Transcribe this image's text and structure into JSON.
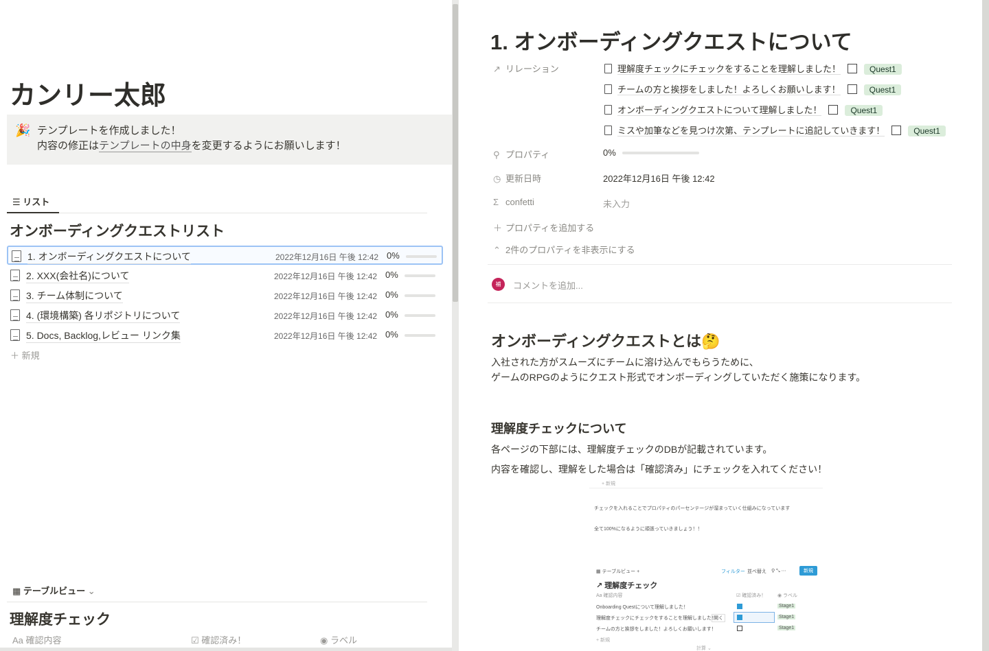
{
  "left": {
    "page_title": "カンリー太郎",
    "callout": {
      "line1": "テンプレートを作成しました！",
      "line2_pre": "内容の修正は",
      "line2_link": "テンプレートの中身",
      "line2_post": "を変更するようにお願いします！"
    },
    "list_tab": "リスト",
    "list_title": "オンボーディングクエストリスト",
    "rows": [
      {
        "name": "1. オンボーディングクエストについて",
        "date": "2022年12月16日 午後 12:42",
        "progress": "0%"
      },
      {
        "name": "2. XXX(会社名)について",
        "date": "2022年12月16日 午後 12:42",
        "progress": "0%"
      },
      {
        "name": "3. チーム体制について",
        "date": "2022年12月16日 午後 12:42",
        "progress": "0%"
      },
      {
        "name": "4. (環境構築) 各リポジトリについて",
        "date": "2022年12月16日 午後 12:42",
        "progress": "0%"
      },
      {
        "name": "5. Docs, Backlog,レビュー リンク集",
        "date": "2022年12月16日 午後 12:42",
        "progress": "0%"
      }
    ],
    "new_label": "新規",
    "table_tab": "テーブルビュー",
    "table_title": "理解度チェック",
    "columns": [
      {
        "icon": "Aa",
        "label": "確認内容"
      },
      {
        "icon": "☑",
        "label": "確認済み！"
      },
      {
        "icon": "◉",
        "label": "ラベル"
      }
    ]
  },
  "right": {
    "page_title": "1. オンボーディングクエストについて",
    "relation_label": "リレーション",
    "relations": [
      {
        "title": "理解度チェックにチェックをすることを理解しました！",
        "tag": "Quest1"
      },
      {
        "title": "チームの方と挨拶をしました！よろしくお願いします！",
        "tag": "Quest1"
      },
      {
        "title": "オンボーディングクエストについて理解しました！",
        "tag": "Quest1"
      },
      {
        "title": "ミスや加筆などを見つけ次第、テンプレートに追記していきます！",
        "tag": "Quest1"
      }
    ],
    "property_label": "プロパティ",
    "property_value": "0%",
    "updated_label": "更新日時",
    "updated_value": "2022年12月16日 午後 12:42",
    "confetti_label": "confetti",
    "confetti_value": "未入力",
    "add_property": "プロパティを追加する",
    "hide_properties": "2件のプロパティを非表示にする",
    "avatar": "補",
    "comment_placeholder": "コメントを追加...",
    "h_about": "オンボーディングクエストとは🤔",
    "about1": "入社された方がスムーズにチームに溶け込んでもらうために、",
    "about2": "ゲームのRPGのようにクエスト形式でオンボーディングしていただく施策になります。",
    "h_check": "理解度チェックについて",
    "check1": "各ページの下部には、理解度チェックのDBが記載されています。",
    "check2": "内容を確認し、理解をした場合は「確認済み」にチェックを入れてください！",
    "embed": {
      "new_top": "+ 新規",
      "text1": "チェックを入れることでプロパティのパーセンテージが溜まっていく仕組みになっています",
      "text2": "全て100%になるように頑張っていきましょう！！",
      "view": "テーブルビュー",
      "filter": "フィルター",
      "sort": "並べ替え",
      "new_btn": "新規",
      "title": "↗ 理解度チェック",
      "col1": "Aa 確認内容",
      "col2": "☑ 確認済み！",
      "col3": "◉ ラベル",
      "rows": [
        {
          "text": "Onboarding Questについて理解しました！",
          "checked": true,
          "tag": "Stage1"
        },
        {
          "text": "理解度チェックにチェックをすることを理解しました！",
          "checked": true,
          "tag": "Stage1"
        },
        {
          "text": "チームの方と挨拶をしました！よろしくお願いします！",
          "checked": false,
          "tag": "Stage1"
        }
      ],
      "open": "開く",
      "new_bottom": "+ 新規",
      "calc": "計算 ⌄"
    }
  }
}
